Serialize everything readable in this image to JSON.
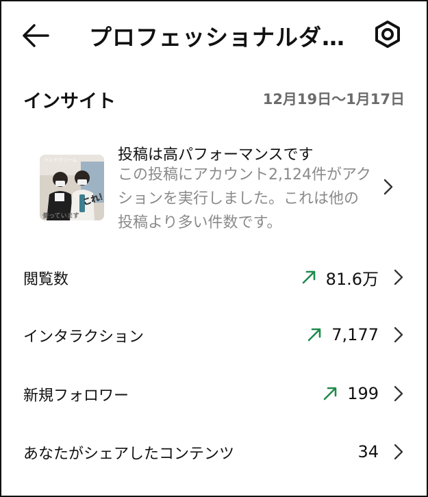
{
  "header": {
    "title": "プロフェッショナルダ…",
    "back_icon": "back-arrow-icon",
    "settings_icon": "settings-gear-icon"
  },
  "insights": {
    "title": "インサイト",
    "date_range": "12月19日〜1月17日"
  },
  "post_card": {
    "headline": "投稿は高パフォーマンスです",
    "description": "この投稿にアカウント2,124件がアクションを実行しました。これは他の投稿より多い件数です。",
    "thumbnail_text_top": "ハンドクリーム",
    "thumbnail_text_right": "これ！",
    "thumbnail_text_bottom": "使っています"
  },
  "metrics": [
    {
      "label": "閲覧数",
      "value": "81.6万",
      "trend": "up"
    },
    {
      "label": "インタラクション",
      "value": "7,177",
      "trend": "up"
    },
    {
      "label": "新規フォロワー",
      "value": "199",
      "trend": "up"
    },
    {
      "label": "あなたがシェアしたコンテンツ",
      "value": "34",
      "trend": "none"
    }
  ],
  "colors": {
    "trend_up": "#1f8a4c",
    "muted_text": "#8a8a8a",
    "date_text": "#6b6b6b"
  }
}
